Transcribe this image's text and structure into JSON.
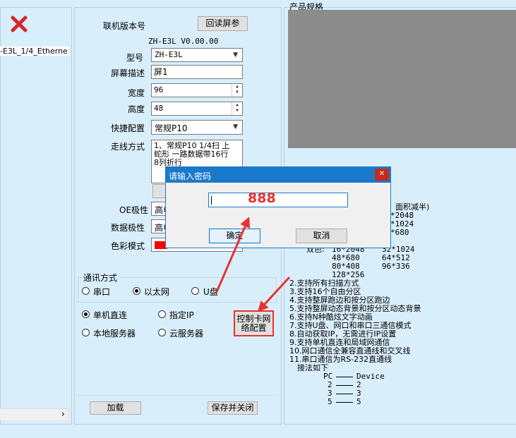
{
  "left_panel": {
    "close_icon": "red-x-icon",
    "tree_item": "-E3L_1/4_Etherne",
    "hscroll_arrow": "›"
  },
  "form": {
    "version_label": "联机版本号",
    "read_params_button": "回读屏参",
    "version_value": "ZH-E3L V0.00.00",
    "model_label": "型号",
    "model_value": "ZH-E3L",
    "screen_desc_label": "屏幕描述",
    "screen_desc_value": "屏1",
    "width_label": "宽度",
    "width_value": "96",
    "height_label": "高度",
    "height_value": "48",
    "quick_config_label": "快捷配置",
    "quick_config_value": "常规P10",
    "routing_label": "走线方式",
    "routing_line1": "1、常规P10  1/4扫 上",
    "routing_line2": "蛇形 一路数据带16行",
    "routing_line3": "8列折行",
    "oe_label": "OE极性",
    "oe_value": "高电",
    "data_polarity_label": "数据极性",
    "data_polarity_value": "高电",
    "color_mode_label": "色彩模式",
    "comm_group_label": "通讯方式",
    "comm_serial": "串口",
    "comm_ethernet": "以太网",
    "comm_usb": "U盘",
    "conn_direct": "单机直连",
    "conn_specified_ip": "指定IP",
    "conn_local_server": "本地服务器",
    "conn_cloud_server": "云服务器",
    "network_config_button_l1": "控制卡网",
    "network_config_button_l2": "络配置",
    "load_button": "加载",
    "save_close_button": "保存并关闭"
  },
  "spec": {
    "title": "产品规格",
    "area_half": "面积减半)",
    "partial_rows": [
      "*2048",
      "*1024",
      "*680"
    ],
    "dual_label": "双色:",
    "dual_col1": [
      "16*2048",
      "48*680",
      "80*408",
      "128*256"
    ],
    "dual_col2": [
      "32*1024",
      "64*512",
      "96*336"
    ],
    "features": [
      "2.支持所有扫描方式",
      "3.支持16个自由分区",
      "4.支持整屏跑边和按分区跑边",
      "5.支持整屏动态背景和按分区动态背景",
      "6.支持N种酷炫文字动画",
      "7.支持U盘、网口和串口三通信模式",
      "8.自动获取IP，无需进行IP设置",
      "9.支持单机直连和局域网通信",
      "10.网口通信全兼容直通线和交叉线",
      "11.串口通信为RS-232直通线",
      "   接法如下"
    ],
    "pin_header_pc": "PC",
    "pin_header_device": "Device",
    "pins": [
      "2",
      "3",
      "5"
    ]
  },
  "dialog": {
    "title": "请输入密码",
    "password_value": "888",
    "ok_button": "确定",
    "cancel_button": "取消"
  },
  "colors": {
    "annotation_arrow": "#e8322f",
    "dialog_titlebar": "#1979ca",
    "color_swatch": "#ff0000"
  }
}
